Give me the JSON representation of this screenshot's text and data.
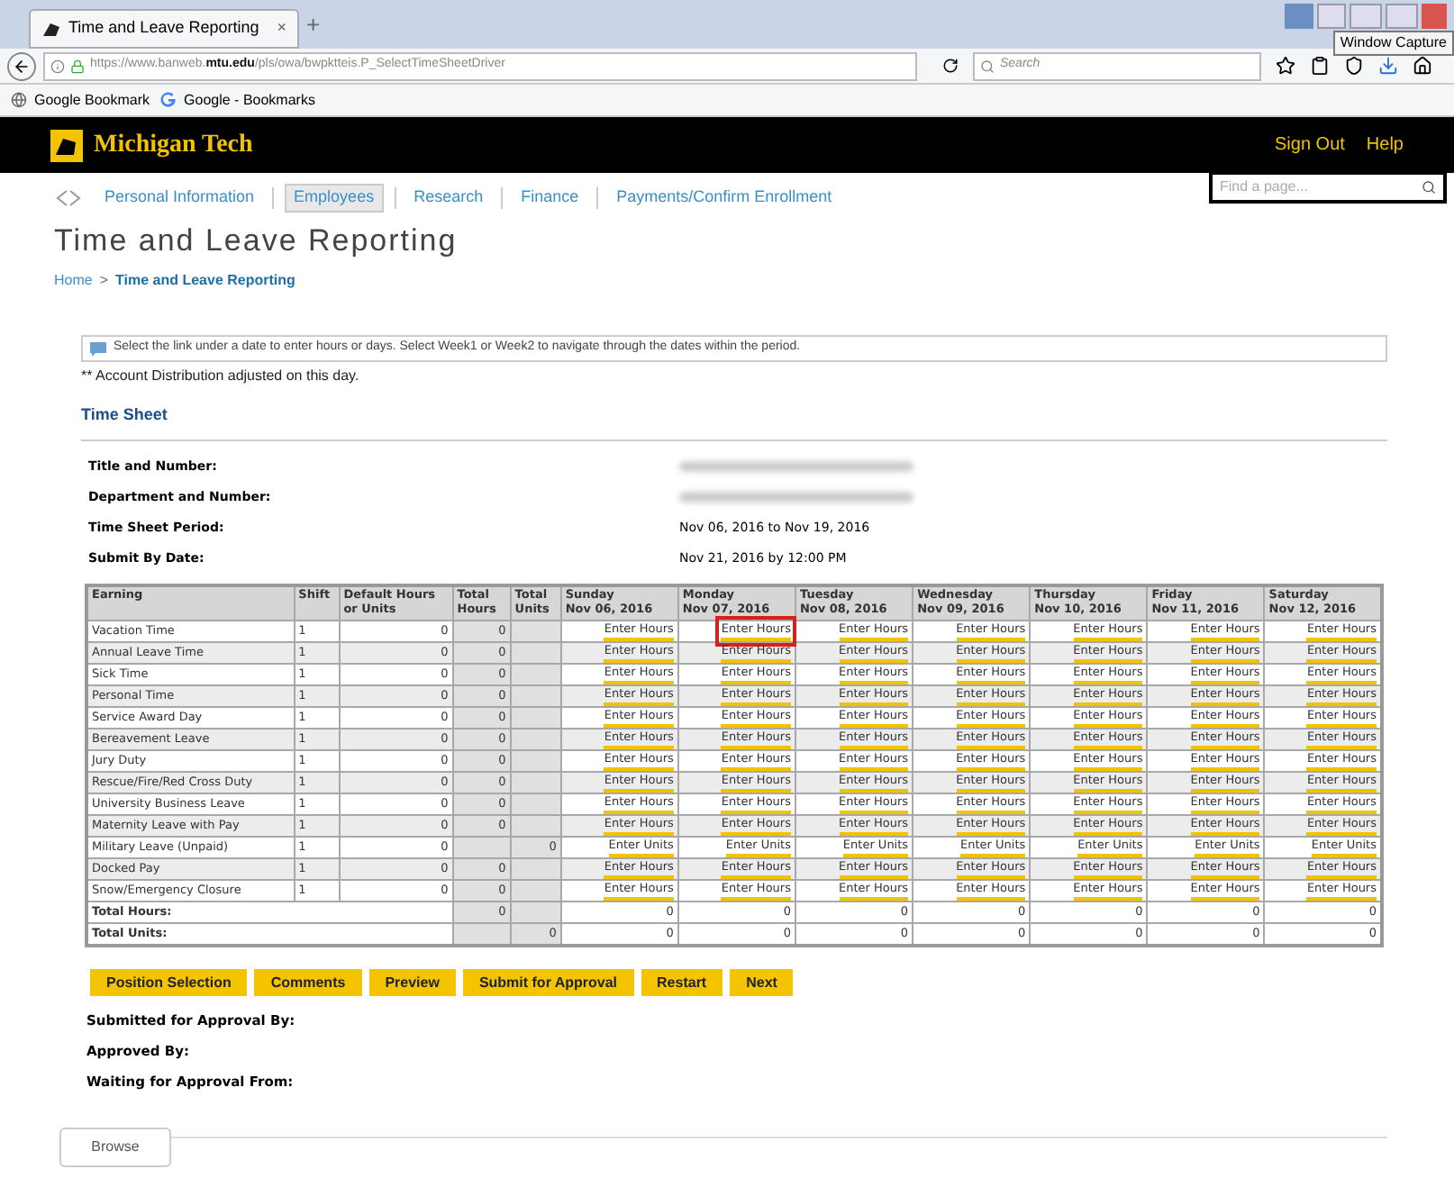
{
  "browser": {
    "tab_title": "Time and Leave Reporting",
    "tab_close": "×",
    "new_tab": "+",
    "url_prefix": "https://www.banweb.",
    "url_domain": "mtu.edu",
    "url_path": "/pls/owa/bwpktteis.P_SelectTimeSheetDriver",
    "search_placeholder": "Search",
    "bookmarks": [
      "Google Bookmark",
      "Google - Bookmarks"
    ],
    "tooltip": "Window Capture"
  },
  "header": {
    "brand": "Michigan Tech",
    "links": [
      "Sign Out",
      "Help"
    ],
    "search_placeholder": "Find a page..."
  },
  "nav": [
    {
      "label": "Personal Information",
      "selected": false
    },
    {
      "label": "Employees",
      "selected": true
    },
    {
      "label": "Research",
      "selected": false
    },
    {
      "label": "Finance",
      "selected": false
    },
    {
      "label": "Payments/Confirm Enrollment",
      "selected": false
    }
  ],
  "title": "Time and Leave Reporting",
  "breadcrumb": [
    "Home",
    ">",
    "Time and Leave Reporting"
  ],
  "info": "Select the link under a date to enter hours or days. Select Week1 or Week2 to navigate through the dates within the period.",
  "note": "** Account Distribution adjusted on this day.",
  "section": "Time Sheet",
  "fields": [
    {
      "label": "Title and Number:"
    },
    {
      "label": "Department and Number:"
    },
    {
      "label": "Time Sheet Period:",
      "value": "Nov 06, 2016 to Nov 19, 2016"
    },
    {
      "label": "Submit By Date:",
      "value": "Nov 21, 2016 by 12:00 PM"
    }
  ],
  "table": {
    "columns": [
      "Earning",
      "Shift",
      "Default Hours or Units",
      "Total Hours",
      "Total Units"
    ],
    "days": [
      {
        "day": "Sunday",
        "date": "Nov 06, 2016"
      },
      {
        "day": "Monday",
        "date": "Nov 07, 2016"
      },
      {
        "day": "Tuesday",
        "date": "Nov 08, 2016"
      },
      {
        "day": "Wednesday",
        "date": "Nov 09, 2016"
      },
      {
        "day": "Thursday",
        "date": "Nov 10, 2016"
      },
      {
        "day": "Friday",
        "date": "Nov 11, 2016"
      },
      {
        "day": "Saturday",
        "date": "Nov 12, 2016"
      }
    ],
    "rows": [
      {
        "earning": "Vacation Time",
        "shift": "1",
        "default": "0",
        "total_hours": "0",
        "cells": [
          {
            "link": "Enter Hours",
            "highlighted": false
          },
          {
            "link": "Enter Hours",
            "highlighted": true
          },
          {
            "link": "Enter Hours",
            "highlighted": false
          },
          {
            "link": "Enter Hours",
            "highlighted": false
          },
          {
            "link": "Enter Hours",
            "highlighted": false
          },
          {
            "link": "Enter Hours",
            "highlighted": false
          },
          {
            "link": "Enter Hours",
            "highlighted": false
          }
        ]
      },
      {
        "earning": "Annual Leave Time",
        "shift": "1",
        "default": "0",
        "total_hours": "0",
        "cells": [
          {
            "link": "Enter Hours",
            "highlighted": false
          },
          {
            "link": "Enter Hours",
            "highlighted": false
          },
          {
            "link": "Enter Hours",
            "highlighted": false
          },
          {
            "link": "Enter Hours",
            "highlighted": false
          },
          {
            "link": "Enter Hours",
            "highlighted": false
          },
          {
            "link": "Enter Hours",
            "highlighted": false
          },
          {
            "link": "Enter Hours",
            "highlighted": false
          }
        ]
      },
      {
        "earning": "Sick Time",
        "shift": "1",
        "default": "0",
        "total_hours": "0",
        "cells": [
          {
            "link": "Enter Hours",
            "highlighted": false
          },
          {
            "link": "Enter Hours",
            "highlighted": false
          },
          {
            "link": "Enter Hours",
            "highlighted": false
          },
          {
            "link": "Enter Hours",
            "highlighted": false
          },
          {
            "link": "Enter Hours",
            "highlighted": false
          },
          {
            "link": "Enter Hours",
            "highlighted": false
          },
          {
            "link": "Enter Hours",
            "highlighted": false
          }
        ]
      },
      {
        "earning": "Personal Time",
        "shift": "1",
        "default": "0",
        "total_hours": "0",
        "cells": [
          {
            "link": "Enter Hours",
            "highlighted": false
          },
          {
            "link": "Enter Hours",
            "highlighted": false
          },
          {
            "link": "Enter Hours",
            "highlighted": false
          },
          {
            "link": "Enter Hours",
            "highlighted": false
          },
          {
            "link": "Enter Hours",
            "highlighted": false
          },
          {
            "link": "Enter Hours",
            "highlighted": false
          },
          {
            "link": "Enter Hours",
            "highlighted": false
          }
        ]
      },
      {
        "earning": "Service Award Day",
        "shift": "1",
        "default": "0",
        "total_hours": "0",
        "cells": [
          {
            "link": "Enter Hours",
            "highlighted": false
          },
          {
            "link": "Enter Hours",
            "highlighted": false
          },
          {
            "link": "Enter Hours",
            "highlighted": false
          },
          {
            "link": "Enter Hours",
            "highlighted": false
          },
          {
            "link": "Enter Hours",
            "highlighted": false
          },
          {
            "link": "Enter Hours",
            "highlighted": false
          },
          {
            "link": "Enter Hours",
            "highlighted": false
          }
        ]
      },
      {
        "earning": "Bereavement Leave",
        "shift": "1",
        "default": "0",
        "total_hours": "0",
        "cells": [
          {
            "link": "Enter Hours",
            "highlighted": false
          },
          {
            "link": "Enter Hours",
            "highlighted": false
          },
          {
            "link": "Enter Hours",
            "highlighted": false
          },
          {
            "link": "Enter Hours",
            "highlighted": false
          },
          {
            "link": "Enter Hours",
            "highlighted": false
          },
          {
            "link": "Enter Hours",
            "highlighted": false
          },
          {
            "link": "Enter Hours",
            "highlighted": false
          }
        ]
      },
      {
        "earning": "Jury Duty",
        "shift": "1",
        "default": "0",
        "total_hours": "0",
        "cells": [
          {
            "link": "Enter Hours",
            "highlighted": false
          },
          {
            "link": "Enter Hours",
            "highlighted": false
          },
          {
            "link": "Enter Hours",
            "highlighted": false
          },
          {
            "link": "Enter Hours",
            "highlighted": false
          },
          {
            "link": "Enter Hours",
            "highlighted": false
          },
          {
            "link": "Enter Hours",
            "highlighted": false
          },
          {
            "link": "Enter Hours",
            "highlighted": false
          }
        ]
      },
      {
        "earning": "Rescue/Fire/Red Cross Duty",
        "shift": "1",
        "default": "0",
        "total_hours": "0",
        "cells": [
          {
            "link": "Enter Hours",
            "highlighted": false
          },
          {
            "link": "Enter Hours",
            "highlighted": false
          },
          {
            "link": "Enter Hours",
            "highlighted": false
          },
          {
            "link": "Enter Hours",
            "highlighted": false
          },
          {
            "link": "Enter Hours",
            "highlighted": false
          },
          {
            "link": "Enter Hours",
            "highlighted": false
          },
          {
            "link": "Enter Hours",
            "highlighted": false
          }
        ]
      },
      {
        "earning": "University Business Leave",
        "shift": "1",
        "default": "0",
        "total_hours": "0",
        "cells": [
          {
            "link": "Enter Hours",
            "highlighted": false
          },
          {
            "link": "Enter Hours",
            "highlighted": false
          },
          {
            "link": "Enter Hours",
            "highlighted": false
          },
          {
            "link": "Enter Hours",
            "highlighted": false
          },
          {
            "link": "Enter Hours",
            "highlighted": false
          },
          {
            "link": "Enter Hours",
            "highlighted": false
          },
          {
            "link": "Enter Hours",
            "highlighted": false
          }
        ]
      },
      {
        "earning": "Maternity Leave with Pay",
        "shift": "1",
        "default": "0",
        "total_hours": "0",
        "cells": [
          {
            "link": "Enter Hours",
            "highlighted": false
          },
          {
            "link": "Enter Hours",
            "highlighted": false
          },
          {
            "link": "Enter Hours",
            "highlighted": false
          },
          {
            "link": "Enter Hours",
            "highlighted": false
          },
          {
            "link": "Enter Hours",
            "highlighted": false
          },
          {
            "link": "Enter Hours",
            "highlighted": false
          },
          {
            "link": "Enter Hours",
            "highlighted": false
          }
        ]
      },
      {
        "earning": "Military Leave (Unpaid)",
        "shift": "1",
        "default": "0",
        "total_units": "0",
        "cells": [
          {
            "link": "Enter Units",
            "highlighted": false
          },
          {
            "link": "Enter Units",
            "highlighted": false
          },
          {
            "link": "Enter Units",
            "highlighted": false
          },
          {
            "link": "Enter Units",
            "highlighted": false
          },
          {
            "link": "Enter Units",
            "highlighted": false
          },
          {
            "link": "Enter Units",
            "highlighted": false
          },
          {
            "link": "Enter Units",
            "highlighted": false
          }
        ]
      },
      {
        "earning": "Docked Pay",
        "shift": "1",
        "default": "0",
        "total_hours": "0",
        "cells": [
          {
            "link": "Enter Hours",
            "highlighted": false
          },
          {
            "link": "Enter Hours",
            "highlighted": false
          },
          {
            "link": "Enter Hours",
            "highlighted": false
          },
          {
            "link": "Enter Hours",
            "highlighted": false
          },
          {
            "link": "Enter Hours",
            "highlighted": false
          },
          {
            "link": "Enter Hours",
            "highlighted": false
          },
          {
            "link": "Enter Hours",
            "highlighted": false
          }
        ]
      },
      {
        "earning": "Snow/Emergency Closure",
        "shift": "1",
        "default": "0",
        "total_hours": "0",
        "cells": [
          {
            "link": "Enter Hours",
            "highlighted": false
          },
          {
            "link": "Enter Hours",
            "highlighted": false
          },
          {
            "link": "Enter Hours",
            "highlighted": false
          },
          {
            "link": "Enter Hours",
            "highlighted": false
          },
          {
            "link": "Enter Hours",
            "highlighted": false
          },
          {
            "link": "Enter Hours",
            "highlighted": false
          },
          {
            "link": "Enter Hours",
            "highlighted": false
          }
        ]
      }
    ],
    "totals": [
      {
        "label": "Total Hours:",
        "total_hours": "0",
        "days": [
          "0",
          "0",
          "0",
          "0",
          "0",
          "0",
          "0"
        ]
      },
      {
        "label": "Total Units:",
        "total_units": "0",
        "days": [
          "0",
          "0",
          "0",
          "0",
          "0",
          "0",
          "0"
        ]
      }
    ]
  },
  "buttons": [
    "Position Selection",
    "Comments",
    "Preview",
    "Submit for Approval",
    "Restart",
    "Next"
  ],
  "approvals": [
    "Submitted for Approval By:",
    "Approved By:",
    "Waiting for Approval From:"
  ],
  "footer_button": "Browse"
}
